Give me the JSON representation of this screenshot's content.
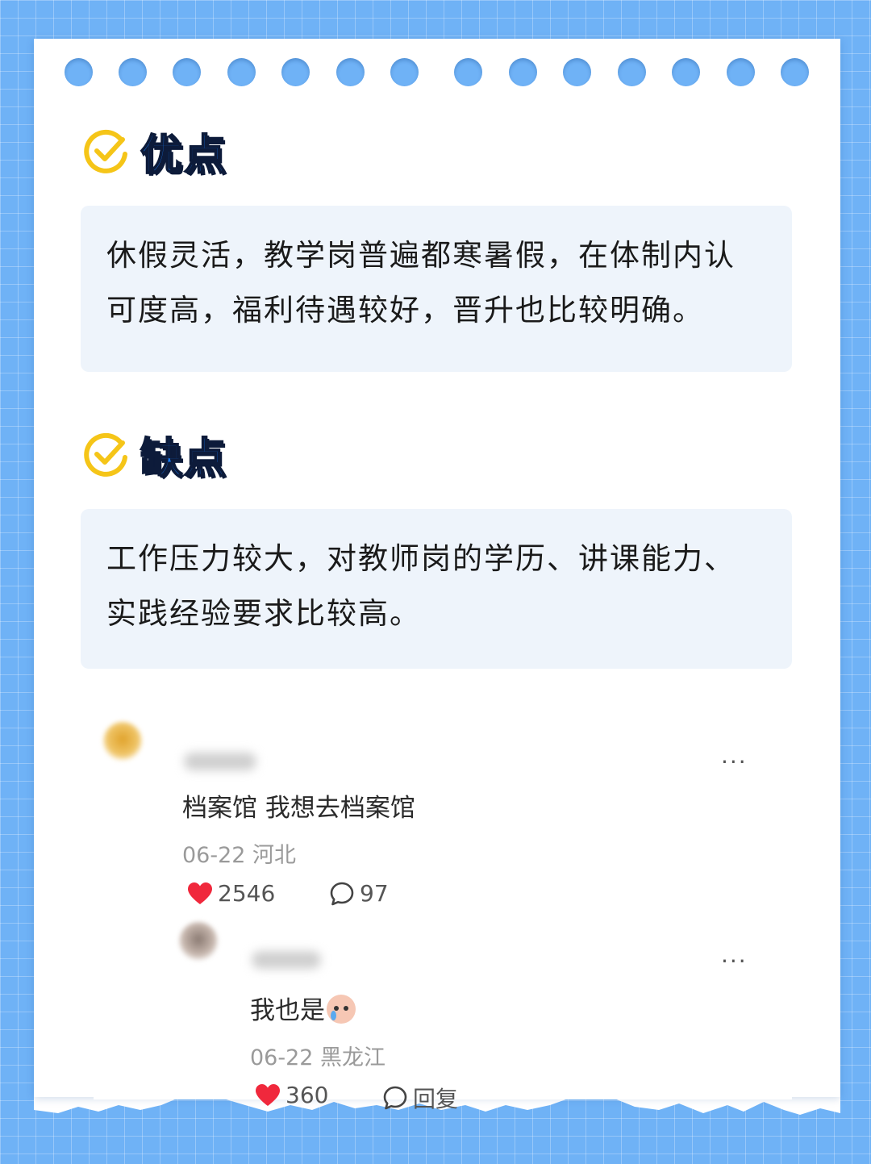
{
  "sections": [
    {
      "title": "优点",
      "lines": [
        "休假灵活，教学岗普遍都寒暑假，在体制内认",
        "可度高，福利待遇较好，晋升也比较明确。"
      ]
    },
    {
      "title": "缺点",
      "lines": [
        "工作压力较大，对教师岗的学历、讲课能力、",
        "实践经验要求比较高。"
      ]
    }
  ],
  "comment": {
    "text": "档案馆 我想去档案馆",
    "date_location": "06-22 河北",
    "likes": "2546",
    "comments": "97",
    "more": "···"
  },
  "reply": {
    "text": "我也是",
    "emoji": "crying-face-emoji",
    "date_location": "06-22 黑龙江",
    "likes": "360",
    "reply_label": "回复",
    "more": "···"
  },
  "colors": {
    "background": "#6fb2f6",
    "accent_blue": "#1677f0",
    "check_yellow": "#f5c518",
    "card_bg": "#eef4fb",
    "heart_red": "#f0283c"
  }
}
